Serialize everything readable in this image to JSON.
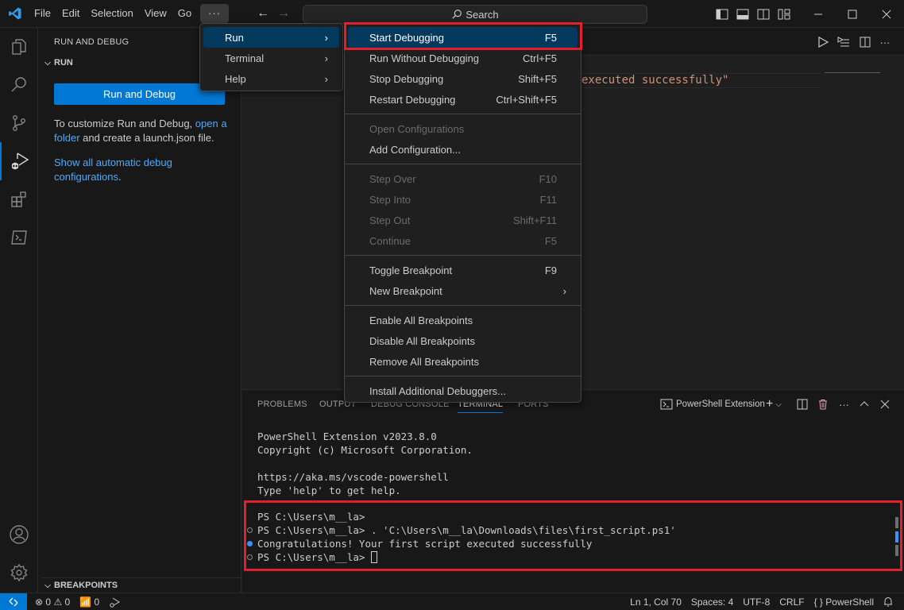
{
  "titlebar": {
    "menus": [
      "File",
      "Edit",
      "Selection",
      "View",
      "Go"
    ],
    "more_label": "···",
    "search_placeholder": "Search"
  },
  "sidebar": {
    "title": "RUN AND DEBUG",
    "section": "RUN",
    "run_button": "Run and Debug",
    "customize_text": "To customize Run and Debug, ",
    "open_folder_link_1": "open a",
    "open_folder_link_2": "folder",
    "customize_text_2": " and create a launch.json file.",
    "show_all_link_1": "Show all automatic debug",
    "show_all_link_2": "configurations",
    "period": ".",
    "breakpoints_section": "BREAKPOINTS"
  },
  "editor": {
    "code_fragment": "executed successfully\""
  },
  "menu_more": {
    "items": [
      {
        "label": "Run",
        "selected": true
      },
      {
        "label": "Terminal"
      },
      {
        "label": "Help"
      }
    ]
  },
  "menu_run": {
    "items": [
      {
        "label": "Start Debugging",
        "shortcut": "F5",
        "selected": true
      },
      {
        "label": "Run Without Debugging",
        "shortcut": "Ctrl+F5"
      },
      {
        "label": "Stop Debugging",
        "shortcut": "Shift+F5"
      },
      {
        "label": "Restart Debugging",
        "shortcut": "Ctrl+Shift+F5"
      },
      {
        "label": "Open Configurations",
        "disabled": true
      },
      {
        "label": "Add Configuration..."
      },
      {
        "label": "Step Over",
        "shortcut": "F10",
        "disabled": true
      },
      {
        "label": "Step Into",
        "shortcut": "F11",
        "disabled": true
      },
      {
        "label": "Step Out",
        "shortcut": "Shift+F11",
        "disabled": true
      },
      {
        "label": "Continue",
        "shortcut": "F5",
        "disabled": true
      },
      {
        "label": "Toggle Breakpoint",
        "shortcut": "F9"
      },
      {
        "label": "New Breakpoint",
        "submenu": true
      },
      {
        "label": "Enable All Breakpoints"
      },
      {
        "label": "Disable All Breakpoints"
      },
      {
        "label": "Remove All Breakpoints"
      },
      {
        "label": "Install Additional Debuggers..."
      }
    ]
  },
  "panel": {
    "tabs": [
      "PROBLEMS",
      "OUTPUT",
      "DEBUG CONSOLE",
      "TERMINAL",
      "PORTS"
    ],
    "active_tab": "TERMINAL",
    "terminal_name": "PowerShell Extension",
    "terminal_lines": [
      "PowerShell Extension v2023.8.0",
      "Copyright (c) Microsoft Corporation.",
      "",
      "https://aka.ms/vscode-powershell",
      "Type 'help' to get help.",
      "",
      "PS C:\\Users\\m__la>",
      "PS C:\\Users\\m__la> . 'C:\\Users\\m__la\\Downloads\\files\\first_script.ps1'",
      "Congratulations! Your first script executed successfully",
      "PS C:\\Users\\m__la> "
    ]
  },
  "statusbar": {
    "errors": "0",
    "warnings": "0",
    "ports": "0",
    "position": "Ln 1, Col 70",
    "spaces": "Spaces: 4",
    "encoding": "UTF-8",
    "eol": "CRLF",
    "language": "PowerShell"
  },
  "colors": {
    "accent": "#0078d4",
    "highlight_border": "#e0202e",
    "menu_selected": "#04395e",
    "link": "#4daafc",
    "string": "#ce9178"
  }
}
